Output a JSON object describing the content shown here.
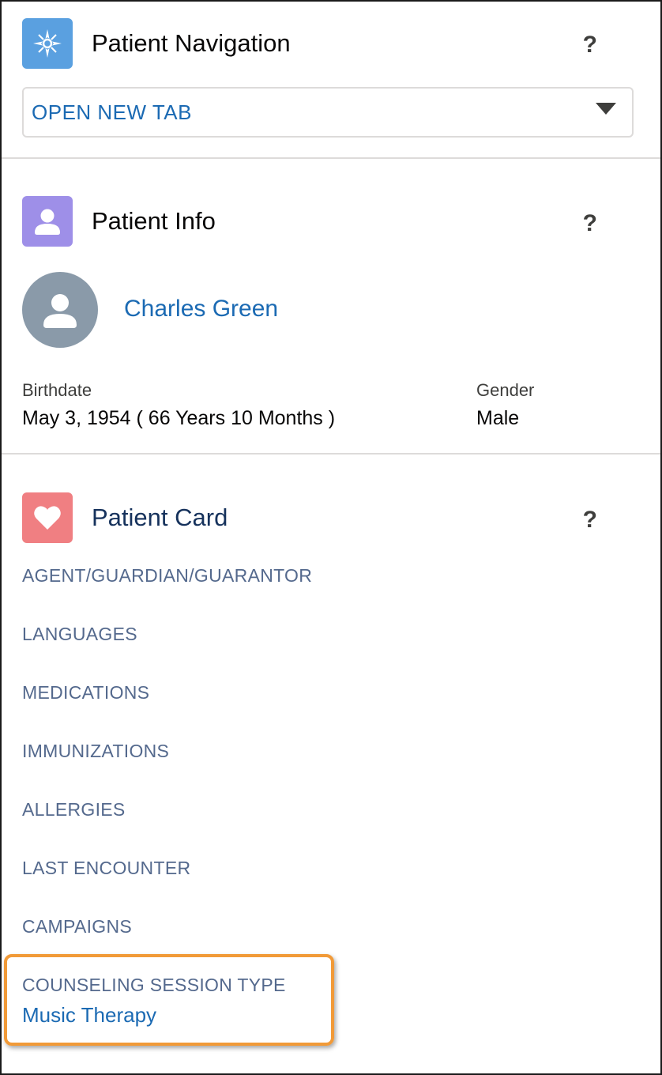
{
  "patient_navigation": {
    "title": "Patient Navigation",
    "help": "?",
    "select_value": "OPEN NEW TAB",
    "icon": "compass-icon",
    "icon_color": "#5aa0e0"
  },
  "patient_info": {
    "title": "Patient Info",
    "help": "?",
    "icon": "user-icon",
    "icon_color": "#9e8fe8",
    "name": "Charles Green",
    "birthdate_label": "Birthdate",
    "birthdate_value": "May 3, 1954 ( 66 Years 10 Months )",
    "gender_label": "Gender",
    "gender_value": "Male"
  },
  "patient_card": {
    "title": "Patient Card",
    "help": "?",
    "icon": "heart-icon",
    "icon_color": "#f07f82",
    "items": [
      "AGENT/GUARDIAN/GUARANTOR",
      "LANGUAGES",
      "MEDICATIONS",
      "IMMUNIZATIONS",
      "ALLERGIES",
      "LAST ENCOUNTER",
      "CAMPAIGNS",
      "COUNSELING SESSION TYPE"
    ],
    "counseling_value": "Music Therapy",
    "highlight_color": "#f19a38"
  },
  "colors": {
    "link": "#1b6ab3",
    "item_text": "#54698d",
    "divider": "#dddbda"
  }
}
